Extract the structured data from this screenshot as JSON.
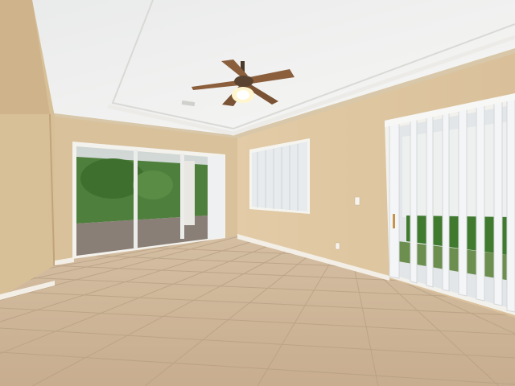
{
  "scene": {
    "room": "empty-room",
    "ceiling_fan": {
      "blades": 5,
      "light": "on",
      "finish": "bronze"
    },
    "floor": "beige-ceramic-tile",
    "walls": "beige",
    "colors": {
      "wall": "#dbc49d",
      "wall_shadow": "#cdb28a",
      "ceiling": "#f1f1ee",
      "floor": "#cdb394",
      "grout": "#b9a083",
      "baseboard": "#f4f1ea",
      "blind": "#eef0f2",
      "foliage": "#3f7a2f",
      "lanai_floor": "#8a7f77"
    }
  }
}
